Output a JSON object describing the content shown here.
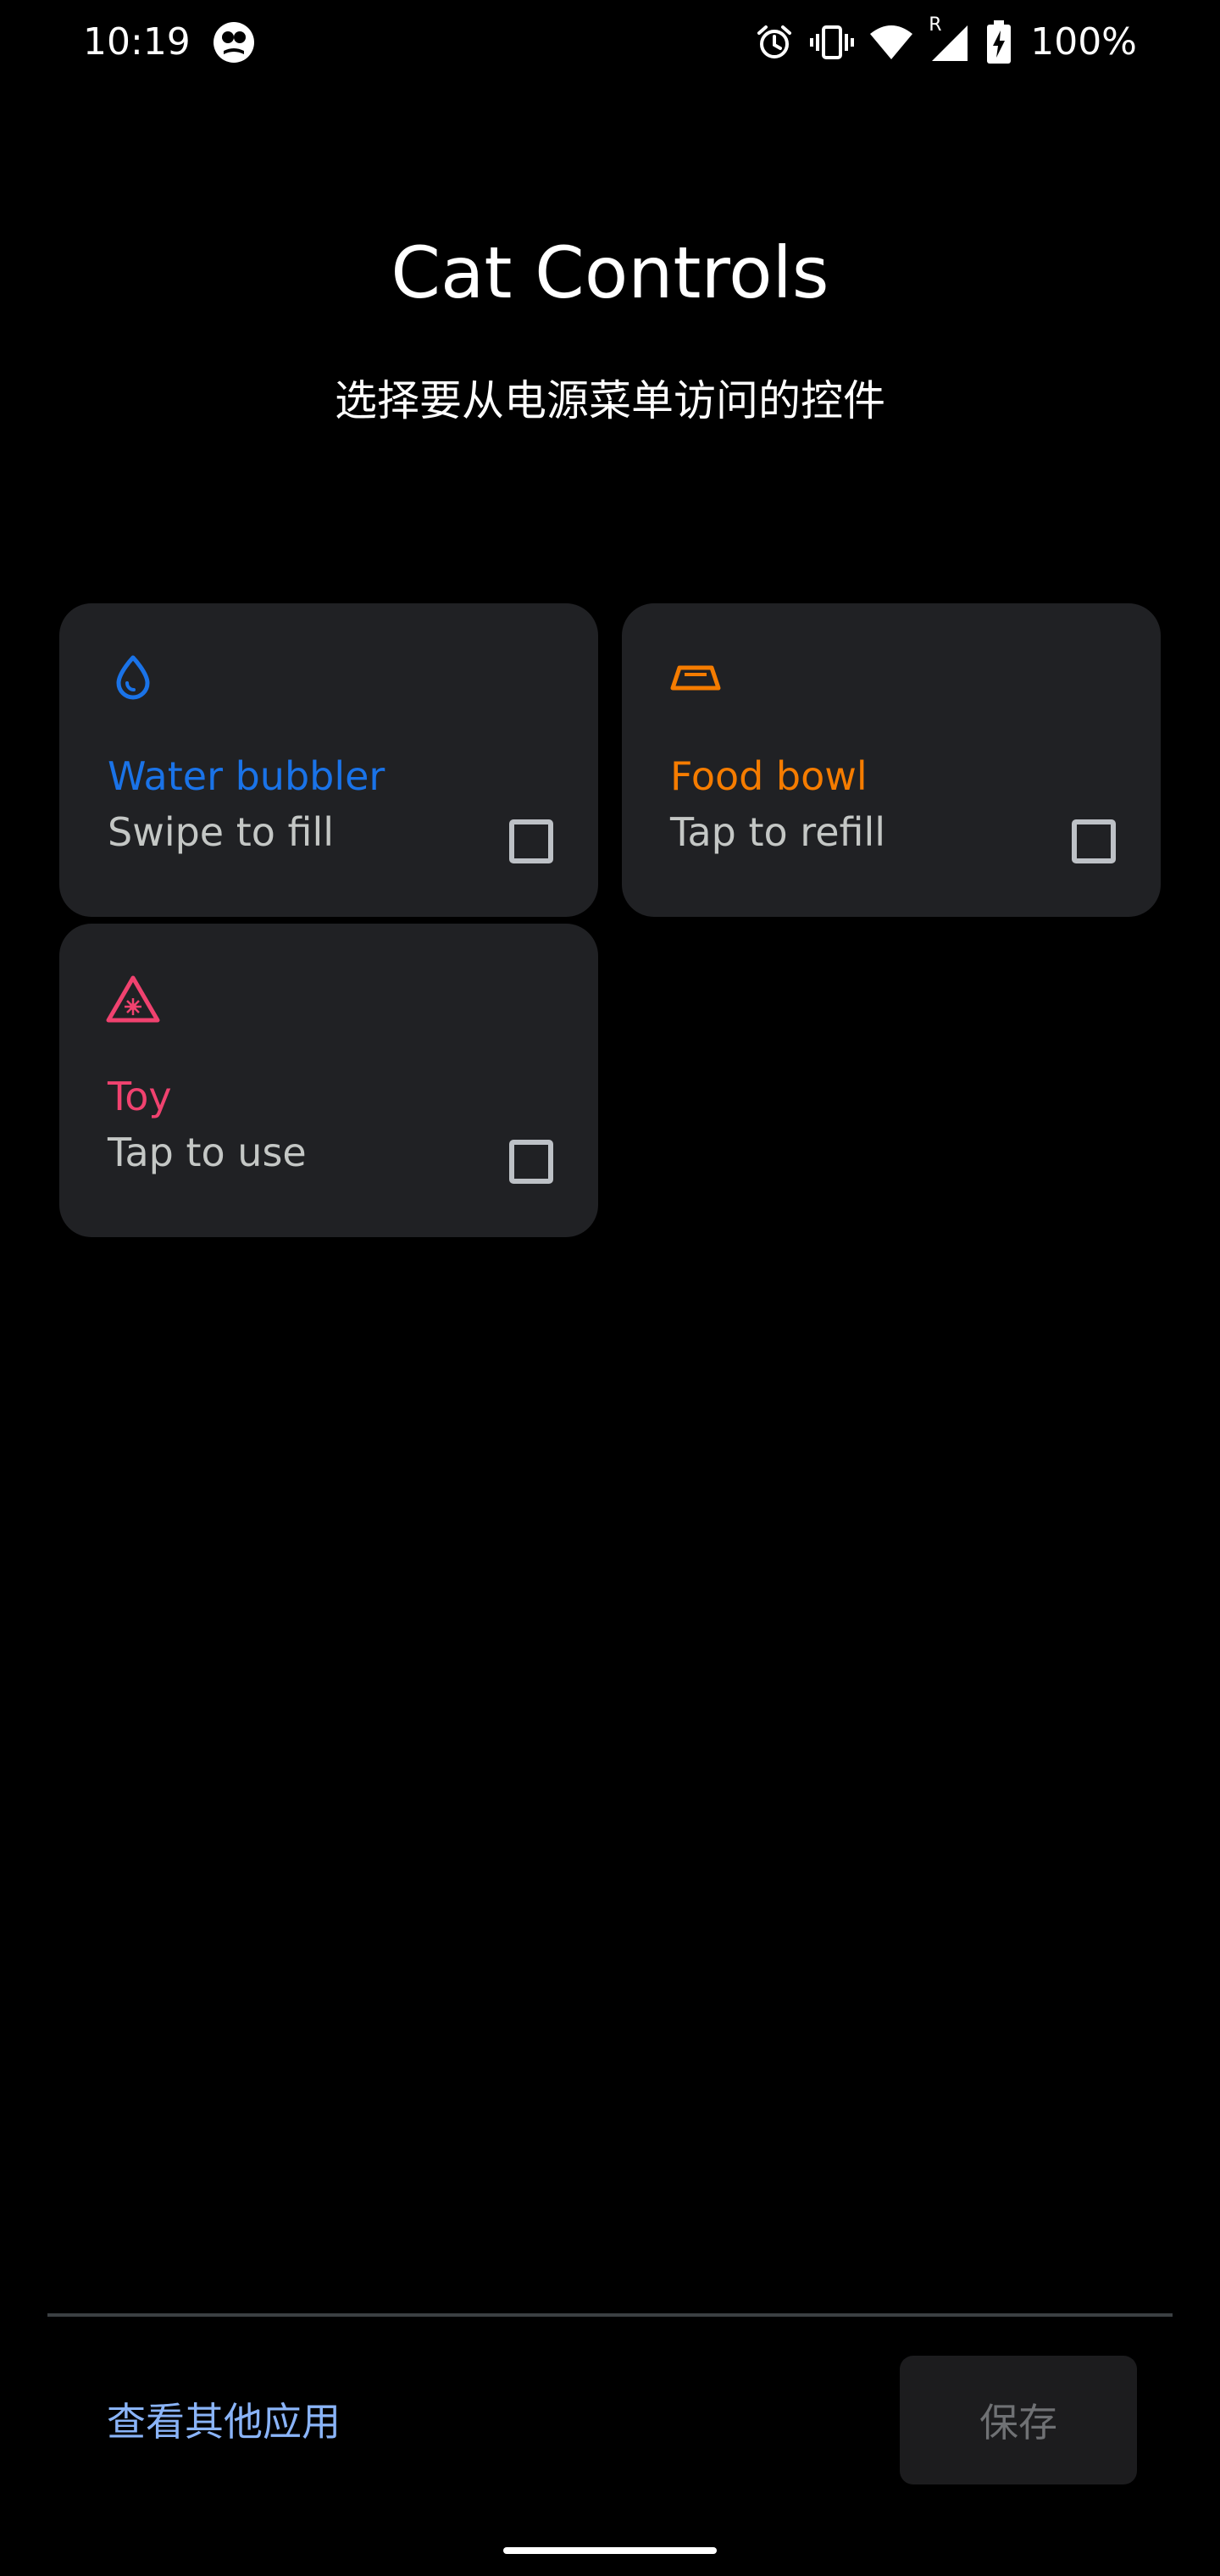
{
  "status_bar": {
    "time": "10:19",
    "app_icon": "incognito-icon",
    "icons": [
      "alarm-icon",
      "vibrate-icon",
      "wifi-icon",
      "signal-roaming-icon",
      "battery-charging-icon"
    ],
    "roaming_label": "R",
    "battery": "100%"
  },
  "header": {
    "title": "Cat Controls",
    "subtitle": "选择要从电源菜单访问的控件"
  },
  "controls": [
    {
      "title": "Water bubbler",
      "subtitle": "Swipe to fill",
      "icon": "water-drop-icon",
      "color": "#1a73e8",
      "checked": false
    },
    {
      "title": "Food bowl",
      "subtitle": "Tap to refill",
      "icon": "food-bowl-icon",
      "color": "#f57c00",
      "checked": false
    },
    {
      "title": "Toy",
      "subtitle": "Tap to use",
      "icon": "laser-warning-icon",
      "color": "#f0426f",
      "checked": false
    }
  ],
  "footer": {
    "other_apps_label": "查看其他应用",
    "save_label": "保存",
    "save_enabled": false
  },
  "colors": {
    "background": "#000000",
    "card": "#202124",
    "link": "#8ab4f8"
  }
}
